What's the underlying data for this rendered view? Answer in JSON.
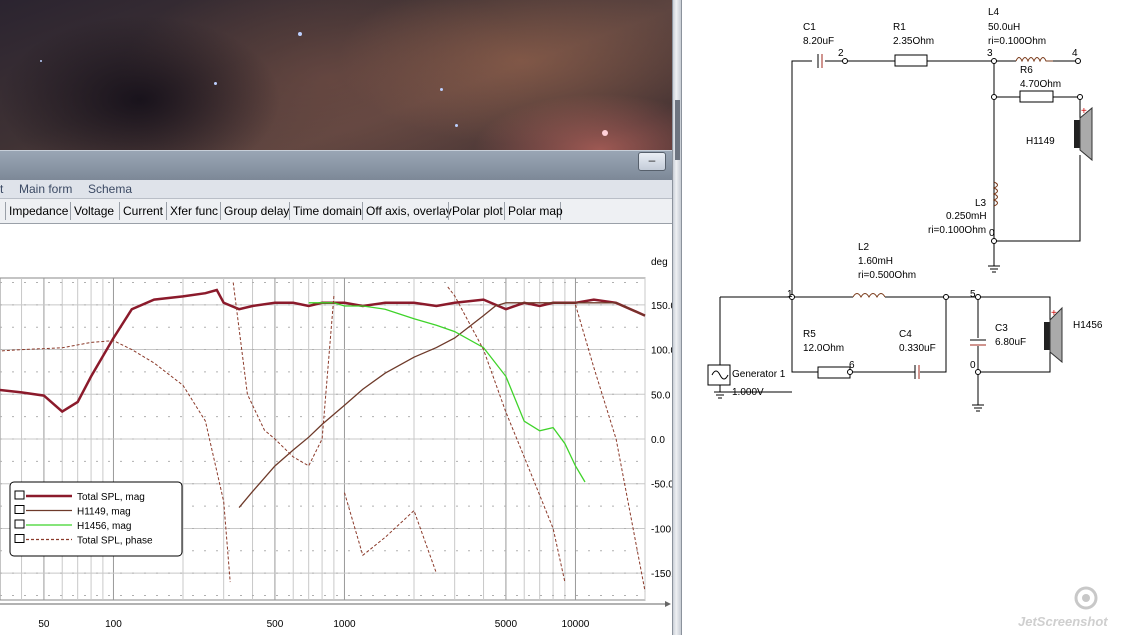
{
  "menu": {
    "items": [
      "t",
      "Main form",
      "Schema"
    ]
  },
  "tabs": [
    "Impedance",
    "Voltage",
    "Current",
    "Xfer func",
    "Group delay",
    "Time domain",
    "Off axis, overlay",
    "Polar plot",
    "Polar map"
  ],
  "window": {
    "minimize_glyph": "–"
  },
  "chart_data": {
    "type": "line",
    "x_scale": "log",
    "xlim": [
      20,
      20000
    ],
    "x_ticks": [
      "50",
      "100",
      "500",
      "1000",
      "5000",
      "10000"
    ],
    "y2_label": "deg",
    "y2_ticks": [
      "150.0",
      "100.0",
      "50.0",
      "0.0",
      "-50.0",
      "-100.0",
      "-150.0"
    ],
    "y2lim": [
      -180,
      180
    ],
    "grid": true,
    "legend_position": "bottom-left",
    "series": [
      {
        "name": "Total SPL, mag",
        "color": "#8b1a2b",
        "style": "solid-thick",
        "rel_level": [
          [
            20,
            -18
          ],
          [
            25,
            -22
          ],
          [
            30,
            -26
          ],
          [
            40,
            -27
          ],
          [
            50,
            -28
          ],
          [
            60,
            -33
          ],
          [
            70,
            -30
          ],
          [
            80,
            -22
          ],
          [
            100,
            -10
          ],
          [
            120,
            -1
          ],
          [
            150,
            2
          ],
          [
            200,
            3
          ],
          [
            250,
            4
          ],
          [
            280,
            5
          ],
          [
            300,
            1
          ],
          [
            350,
            -1
          ],
          [
            400,
            0
          ],
          [
            500,
            1
          ],
          [
            600,
            1
          ],
          [
            700,
            0
          ],
          [
            800,
            1
          ],
          [
            900,
            1
          ],
          [
            1000,
            1
          ],
          [
            1200,
            0
          ],
          [
            1500,
            1
          ],
          [
            2000,
            1
          ],
          [
            2500,
            0
          ],
          [
            3000,
            1
          ],
          [
            4000,
            2
          ],
          [
            5000,
            -1
          ],
          [
            6000,
            1
          ],
          [
            7000,
            0
          ],
          [
            8000,
            1
          ],
          [
            10000,
            1
          ],
          [
            12000,
            2
          ],
          [
            15000,
            1
          ],
          [
            20000,
            -3
          ]
        ]
      },
      {
        "name": "H1149, mag",
        "color": "#6e3a2a",
        "style": "solid",
        "rel_level": [
          [
            350,
            -63
          ],
          [
            400,
            -58
          ],
          [
            500,
            -50
          ],
          [
            600,
            -45
          ],
          [
            700,
            -41
          ],
          [
            800,
            -37
          ],
          [
            1000,
            -31
          ],
          [
            1200,
            -26
          ],
          [
            1500,
            -21
          ],
          [
            2000,
            -16
          ],
          [
            2500,
            -13
          ],
          [
            3000,
            -10
          ],
          [
            4000,
            -3
          ],
          [
            4500,
            0
          ],
          [
            5000,
            1
          ],
          [
            6000,
            1
          ],
          [
            8000,
            1
          ],
          [
            10000,
            1
          ],
          [
            15000,
            1
          ],
          [
            20000,
            -3
          ]
        ]
      },
      {
        "name": "H1456, mag",
        "color": "#3fd32a",
        "style": "solid",
        "rel_level": [
          [
            700,
            1
          ],
          [
            800,
            1
          ],
          [
            900,
            1
          ],
          [
            1000,
            0
          ],
          [
            1200,
            0
          ],
          [
            1500,
            -1
          ],
          [
            2000,
            -4
          ],
          [
            2500,
            -6
          ],
          [
            3000,
            -8
          ],
          [
            4000,
            -13
          ],
          [
            5000,
            -22
          ],
          [
            6000,
            -36
          ],
          [
            7000,
            -39
          ],
          [
            8000,
            -38
          ],
          [
            9000,
            -43
          ],
          [
            10000,
            -50
          ],
          [
            11000,
            -55
          ]
        ]
      },
      {
        "name": "Total SPL, phase",
        "color": "#8b3a2a",
        "style": "dashed",
        "deg": [
          [
            20,
            95
          ],
          [
            40,
            100
          ],
          [
            60,
            102
          ],
          [
            80,
            108
          ],
          [
            100,
            110
          ],
          [
            120,
            100
          ],
          [
            150,
            85
          ],
          [
            200,
            60
          ],
          [
            250,
            20
          ],
          [
            300,
            -70
          ],
          [
            320,
            -160
          ],
          [
            330,
            175
          ],
          [
            380,
            50
          ],
          [
            450,
            10
          ],
          [
            500,
            0
          ],
          [
            600,
            -20
          ],
          [
            700,
            -30
          ],
          [
            800,
            0
          ],
          [
            900,
            160
          ],
          [
            1000,
            -60
          ],
          [
            1200,
            -130
          ],
          [
            1500,
            -110
          ],
          [
            2000,
            -80
          ],
          [
            2500,
            -150
          ],
          [
            2800,
            170
          ],
          [
            3000,
            160
          ],
          [
            4000,
            100
          ],
          [
            5000,
            30
          ],
          [
            6000,
            -20
          ],
          [
            8000,
            -100
          ],
          [
            9000,
            -160
          ],
          [
            10000,
            150
          ],
          [
            12000,
            80
          ],
          [
            15000,
            0
          ],
          [
            20000,
            -170
          ]
        ]
      }
    ]
  },
  "schematic": {
    "C1": {
      "name": "C1",
      "value": "8.20uF"
    },
    "R1": {
      "name": "R1",
      "value": "2.35Ohm"
    },
    "L4": {
      "name": "L4",
      "value": "50.0uH",
      "ri": "ri=0.100Ohm"
    },
    "R6": {
      "name": "R6",
      "value": "4.70Ohm"
    },
    "H1149": "H1149",
    "L3": {
      "name": "L3",
      "value": "0.250mH",
      "ri": "ri=0.100Ohm"
    },
    "L2": {
      "name": "L2",
      "value": "1.60mH",
      "ri": "ri=0.500Ohm"
    },
    "R5": {
      "name": "R5",
      "value": "12.0Ohm"
    },
    "C4": {
      "name": "C4",
      "value": "0.330uF"
    },
    "C3": {
      "name": "C3",
      "value": "6.80uF"
    },
    "H1456": "H1456",
    "generator": {
      "name": "Generator 1",
      "value": "1.000V"
    },
    "nodes": [
      "1",
      "2",
      "3",
      "4",
      "5",
      "6",
      "0",
      "0",
      "0"
    ]
  },
  "watermark": "JetScreenshot",
  "colors": {
    "total_spl": "#8b1a2b",
    "h1149": "#6e3a2a",
    "h1456": "#3fd32a",
    "phase": "#8b3a2a",
    "tab_text": "#000000",
    "menu_text": "#3c4a64"
  }
}
